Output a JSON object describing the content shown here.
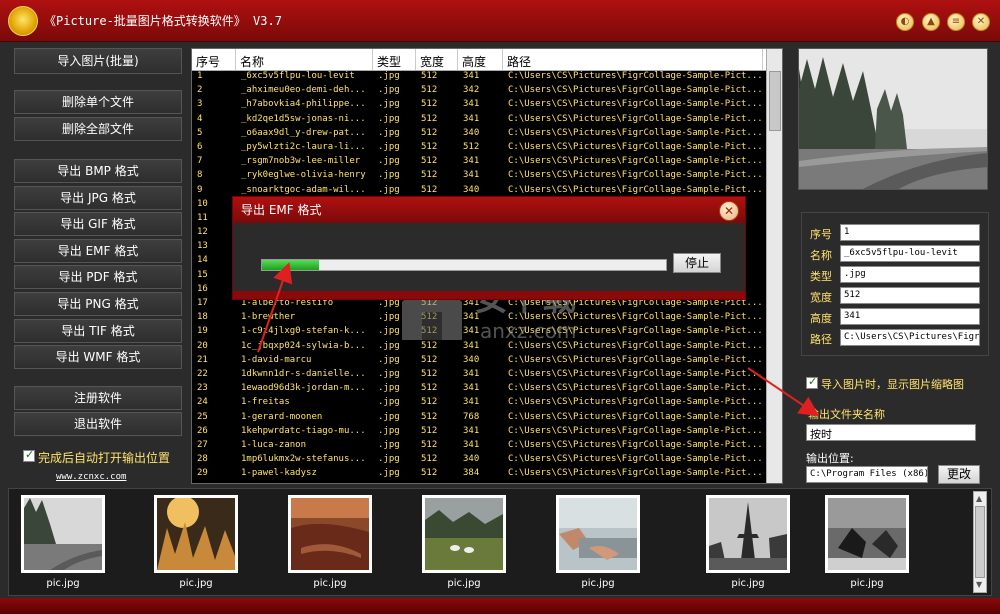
{
  "app": {
    "title": "《Picture-批量图片格式转换软件》 V3.7"
  },
  "sidebar": {
    "import_button": "导入图片(批量)",
    "delete_single": "删除单个文件",
    "delete_all": "删除全部文件",
    "exports": [
      "导出 BMP 格式",
      "导出 JPG 格式",
      "导出 GIF 格式",
      "导出 EMF 格式",
      "导出 PDF 格式",
      "导出 PNG 格式",
      "导出 TIF 格式",
      "导出 WMF 格式"
    ],
    "register": "注册软件",
    "exit": "退出软件",
    "auto_open_label": "完成后自动打开输出位置",
    "website": "www.zcnxc.com"
  },
  "table": {
    "headers": [
      "序号",
      "名称",
      "类型",
      "宽度",
      "高度",
      "路径"
    ],
    "rows": [
      [
        "1",
        "_6xc5v5flpu-lou-levit",
        ".jpg",
        "512",
        "341",
        "C:\\Users\\CS\\Pictures\\FigrCollage-Sample-Pict..."
      ],
      [
        "2",
        "_ahximeu0eo-demi-deh...",
        ".jpg",
        "512",
        "342",
        "C:\\Users\\CS\\Pictures\\FigrCollage-Sample-Pict..."
      ],
      [
        "3",
        "_h7abovkia4-philippe...",
        ".jpg",
        "512",
        "341",
        "C:\\Users\\CS\\Pictures\\FigrCollage-Sample-Pict..."
      ],
      [
        "4",
        "_kd2qe1d5sw-jonas-ni...",
        ".jpg",
        "512",
        "341",
        "C:\\Users\\CS\\Pictures\\FigrCollage-Sample-Pict..."
      ],
      [
        "5",
        "_o6aax9dl_y-drew-pat...",
        ".jpg",
        "512",
        "340",
        "C:\\Users\\CS\\Pictures\\FigrCollage-Sample-Pict..."
      ],
      [
        "6",
        "_py5wlzti2c-laura-li...",
        ".jpg",
        "512",
        "512",
        "C:\\Users\\CS\\Pictures\\FigrCollage-Sample-Pict..."
      ],
      [
        "7",
        "_rsgm7nob3w-lee-miller",
        ".jpg",
        "512",
        "341",
        "C:\\Users\\CS\\Pictures\\FigrCollage-Sample-Pict..."
      ],
      [
        "8",
        "_ryk0eglwe-olivia-henry",
        ".jpg",
        "512",
        "341",
        "C:\\Users\\CS\\Pictures\\FigrCollage-Sample-Pict..."
      ],
      [
        "9",
        "_snoarktgoc-adam-wil...",
        ".jpg",
        "512",
        "340",
        "C:\\Users\\CS\\Pictures\\FigrCollage-Sample-Pict..."
      ],
      [
        "10",
        "",
        "",
        "",
        "",
        ""
      ],
      [
        "11",
        "",
        "",
        "",
        "",
        ""
      ],
      [
        "12",
        "",
        "",
        "",
        "",
        ""
      ],
      [
        "13",
        "",
        "",
        "",
        "",
        ""
      ],
      [
        "14",
        "",
        "",
        "",
        "",
        ""
      ],
      [
        "15",
        "",
        "",
        "",
        "",
        ""
      ],
      [
        "16",
        "",
        "",
        "",
        "",
        ""
      ],
      [
        "17",
        "1-alberto-restifo",
        ".jpg",
        "512",
        "341",
        "C:\\Users\\CS\\Pictures\\FigrCollage-Sample-Pict..."
      ],
      [
        "18",
        "1-brewther",
        ".jpg",
        "512",
        "341",
        "C:\\Users\\CS\\Pictures\\FigrCollage-Sample-Pict..."
      ],
      [
        "19",
        "1-c9z4jlxg0-stefan-k...",
        ".jpg",
        "512",
        "341",
        "C:\\Users\\CS\\Pictures\\FigrCollage-Sample-Pict..."
      ],
      [
        "20",
        "1c_jbqxp024-sylwia-b...",
        ".jpg",
        "512",
        "341",
        "C:\\Users\\CS\\Pictures\\FigrCollage-Sample-Pict..."
      ],
      [
        "21",
        "1-david-marcu",
        ".jpg",
        "512",
        "340",
        "C:\\Users\\CS\\Pictures\\FigrCollage-Sample-Pict..."
      ],
      [
        "22",
        "1dkwnn1dr-s-danielle...",
        ".jpg",
        "512",
        "341",
        "C:\\Users\\CS\\Pictures\\FigrCollage-Sample-Pict..."
      ],
      [
        "23",
        "1ewaod96d3k-jordan-m...",
        ".jpg",
        "512",
        "341",
        "C:\\Users\\CS\\Pictures\\FigrCollage-Sample-Pict..."
      ],
      [
        "24",
        "1-freitas",
        ".jpg",
        "512",
        "341",
        "C:\\Users\\CS\\Pictures\\FigrCollage-Sample-Pict..."
      ],
      [
        "25",
        "1-gerard-moonen",
        ".jpg",
        "512",
        "768",
        "C:\\Users\\CS\\Pictures\\FigrCollage-Sample-Pict..."
      ],
      [
        "26",
        "1kehpwrdatc-tiago-mu...",
        ".jpg",
        "512",
        "341",
        "C:\\Users\\CS\\Pictures\\FigrCollage-Sample-Pict..."
      ],
      [
        "27",
        "1-luca-zanon",
        ".jpg",
        "512",
        "341",
        "C:\\Users\\CS\\Pictures\\FigrCollage-Sample-Pict..."
      ],
      [
        "28",
        "1mp6lukmx2w-stefanus...",
        ".jpg",
        "512",
        "340",
        "C:\\Users\\CS\\Pictures\\FigrCollage-Sample-Pict..."
      ],
      [
        "29",
        "1-pawel-kadysz",
        ".jpg",
        "512",
        "384",
        "C:\\Users\\CS\\Pictures\\FigrCollage-Sample-Pict..."
      ]
    ]
  },
  "dialog": {
    "title": "导出 EMF 格式",
    "progress": 0.14,
    "stop_label": "停止",
    "close_icon": "close-icon"
  },
  "info": {
    "labels": [
      "序号",
      "名称",
      "类型",
      "宽度",
      "高度",
      "路径"
    ],
    "values": [
      "1",
      "_6xc5v5flpu-lou-levit",
      ".jpg",
      "512",
      "341",
      "C:\\Users\\CS\\Pictures\\FigrC"
    ]
  },
  "options": {
    "show_thumbnail_label": "导入图片时，显示图片缩略图",
    "folder_name_label": "输出文件夹名称",
    "folder_name_value": "按时",
    "output_location_label": "输出位置:",
    "output_location_value": "C:\\Program Files (x86)",
    "change_button": "更改"
  },
  "gallery": {
    "labels": [
      "pic.jpg",
      "pic.jpg",
      "pic.jpg",
      "pic.jpg",
      "pic.jpg",
      "pic.jpg",
      "pic.jpg"
    ]
  },
  "colors": {
    "title_red": "#b01010",
    "text_yellow": "#ffe36b",
    "progress_green": "#1ea01e"
  }
}
